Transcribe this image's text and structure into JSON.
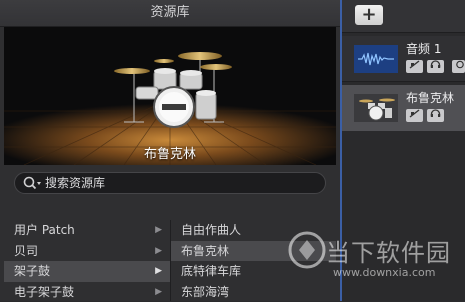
{
  "library": {
    "title": "资源库",
    "preview_name": "布鲁克林",
    "search_placeholder": "搜索资源库",
    "categories": [
      {
        "label": "用户 Patch"
      },
      {
        "label": "贝司"
      },
      {
        "label": "架子鼓"
      },
      {
        "label": "电子架子鼓"
      }
    ],
    "subcategories": [
      {
        "label": "自由作曲人"
      },
      {
        "label": "布鲁克林"
      },
      {
        "label": "底特律车库"
      },
      {
        "label": "东部海湾"
      }
    ]
  },
  "tracks": {
    "add_label": "+",
    "items": [
      {
        "name": "音频 1",
        "mute": "M",
        "headphones": "H",
        "icon": "audio-waveform-icon"
      },
      {
        "name": "布鲁克林",
        "mute": "M",
        "headphones": "H",
        "icon": "drum-kit-icon"
      }
    ]
  },
  "watermark": {
    "text": "当下软件园",
    "url": "www.downxia.com"
  },
  "colors": {
    "accent_divider": "#3b5fa6",
    "selected_row": "#4a4a4d"
  }
}
